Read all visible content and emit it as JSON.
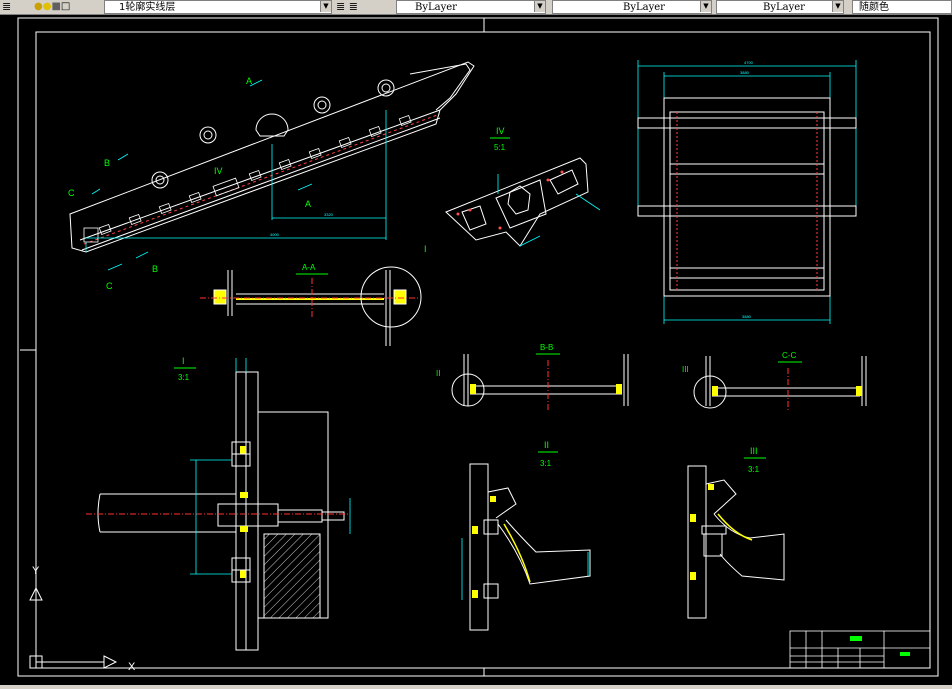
{
  "toolbar": {
    "layer_name": "1轮廓实线层",
    "color_value": "ByLayer",
    "linetype_value": "ByLayer",
    "lineweight_value": "ByLayer",
    "plotstyle_value": "随颜色"
  },
  "drawing": {
    "main_view": {
      "section_labels": [
        "A",
        "A",
        "B",
        "B",
        "C",
        "C",
        "IV",
        "I"
      ],
      "dimensions": [
        "3320",
        "4000"
      ]
    },
    "detail_iv": {
      "title": "IV",
      "scale": "5:1"
    },
    "section_aa": {
      "title": "A-A"
    },
    "section_bb": {
      "title": "B-B",
      "marker": "II"
    },
    "section_cc": {
      "title": "C-C",
      "marker": "III"
    },
    "detail_i": {
      "title": "I",
      "scale": "3:1"
    },
    "detail_ii": {
      "title": "II",
      "scale": "3:1"
    },
    "detail_iii": {
      "title": "III",
      "scale": "3:1"
    },
    "top_view": {
      "dimensions": [
        "4700",
        "3880",
        "3880"
      ]
    },
    "ucs": {
      "y_label": "Y",
      "x_label": "X"
    }
  },
  "colors": {
    "background": "#000000",
    "line_white": "#ffffff",
    "line_cyan": "#00ffff",
    "line_red": "#ff0000",
    "line_yellow": "#ffff00",
    "line_green": "#00ff00",
    "toolbar_bg": "#d4d0c8"
  }
}
